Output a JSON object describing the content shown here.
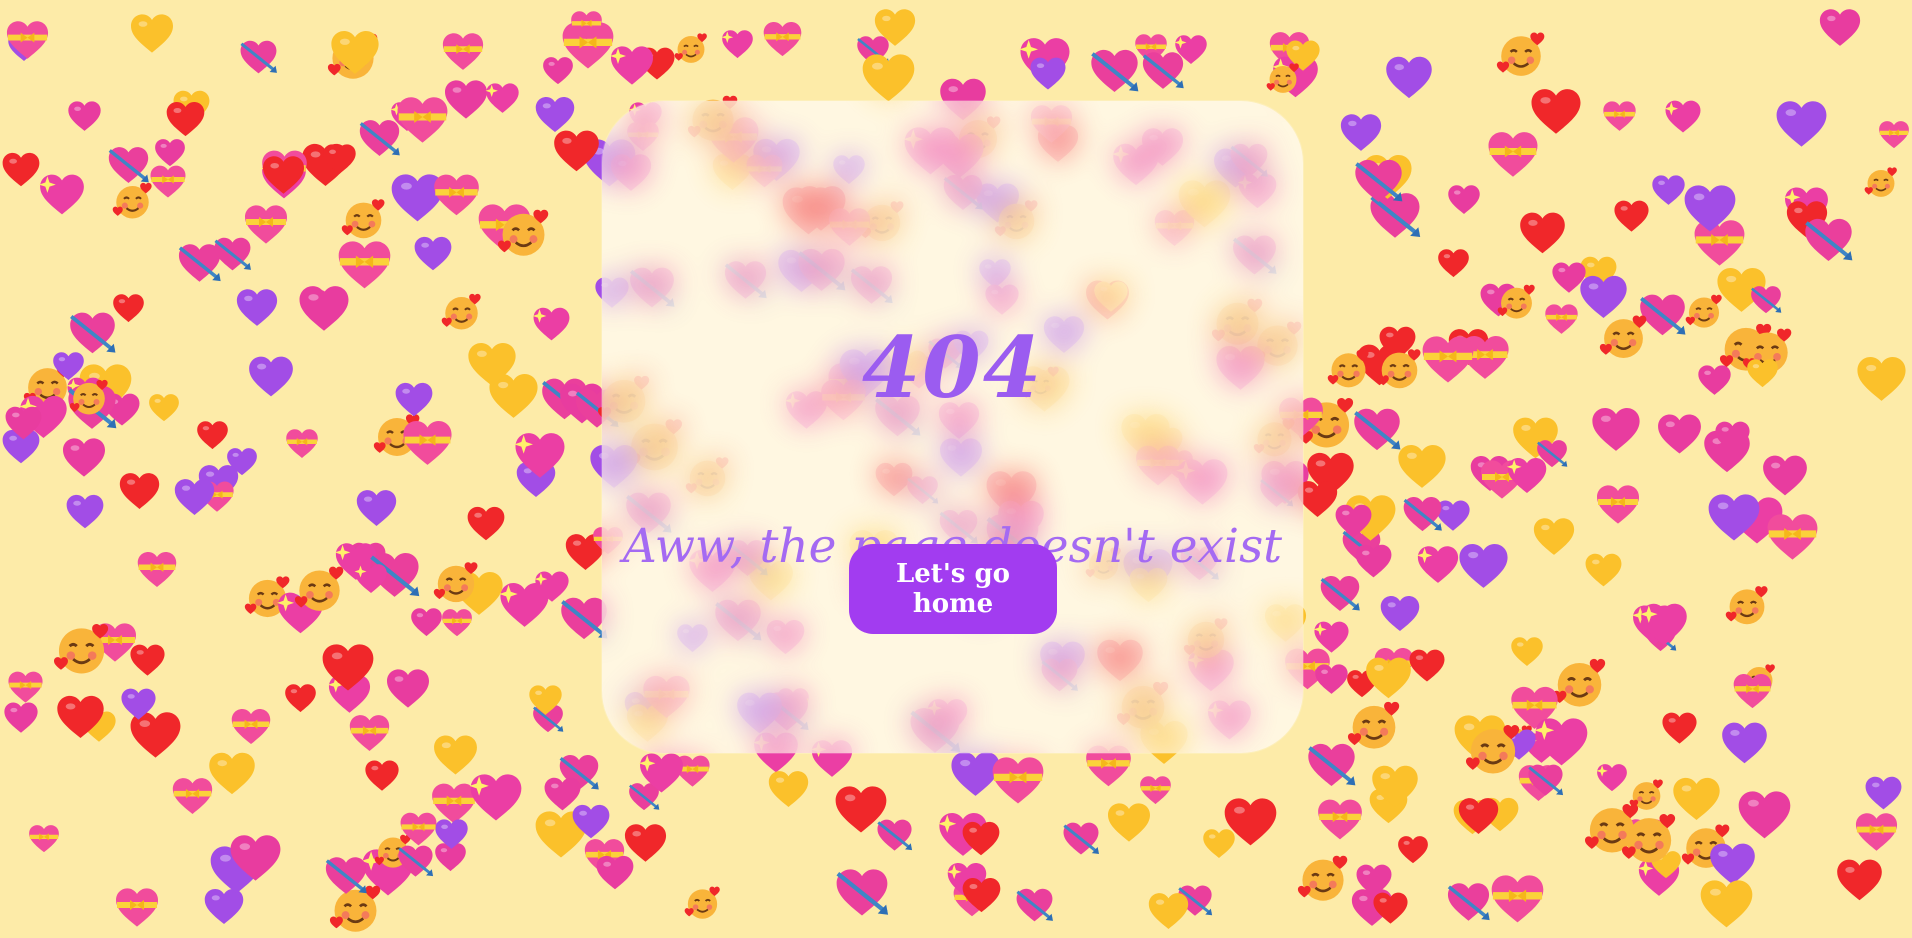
{
  "page": {
    "background_color": "#fdeba8",
    "accent_color": "#a23cf0",
    "text_color": "#9b5cf0"
  },
  "background": {
    "icons": [
      "heart-purple-icon",
      "heart-red-icon",
      "heart-gold-icon",
      "heart-pink-icon",
      "heart-with-arrow-icon",
      "heart-with-ribbon-icon",
      "smiling-face-with-hearts-icon",
      "sparkling-heart-icon"
    ]
  },
  "error": {
    "code": "404",
    "message": "Aww, the page doesn't exist",
    "home_button_label": "Let's go home"
  }
}
